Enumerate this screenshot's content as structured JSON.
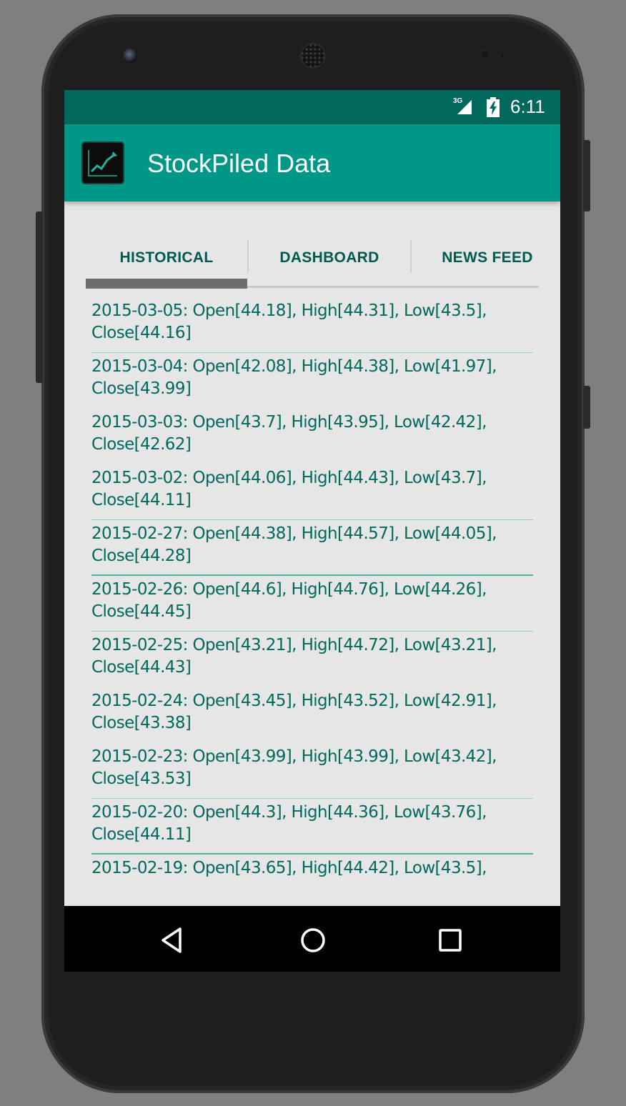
{
  "status_bar": {
    "network": "3G",
    "time": "6:11"
  },
  "app_bar": {
    "title": "StockPiled Data",
    "icon": "stock-chart-icon"
  },
  "tabs": [
    {
      "label": "HISTORICAL",
      "selected": true
    },
    {
      "label": "DASHBOARD",
      "selected": false
    },
    {
      "label": "NEWS FEED",
      "selected": false
    }
  ],
  "history": [
    {
      "line1": "2015-03-05: Open[44.18], High[44.31], Low[43.5],",
      "line2": "Close[44.16]"
    },
    {
      "line1": "2015-03-04: Open[42.08], High[44.38], Low[41.97],",
      "line2": "Close[43.99]"
    },
    {
      "line1": "2015-03-03: Open[43.7], High[43.95], Low[42.42],",
      "line2": "Close[42.62]"
    },
    {
      "line1": "2015-03-02: Open[44.06], High[44.43], Low[43.7],",
      "line2": "Close[44.11]"
    },
    {
      "line1": "2015-02-27: Open[44.38], High[44.57], Low[44.05],",
      "line2": "Close[44.28]"
    },
    {
      "line1": "2015-02-26: Open[44.6], High[44.76], Low[44.26],",
      "line2": "Close[44.45]"
    },
    {
      "line1": "2015-02-25: Open[43.21], High[44.72], Low[43.21],",
      "line2": "Close[44.43]"
    },
    {
      "line1": "2015-02-24: Open[43.45], High[43.52], Low[42.91],",
      "line2": "Close[43.38]"
    },
    {
      "line1": "2015-02-23: Open[43.99], High[43.99], Low[43.42],",
      "line2": "Close[43.53]"
    },
    {
      "line1": "2015-02-20: Open[44.3], High[44.36], Low[43.76],",
      "line2": "Close[44.11]"
    },
    {
      "line1": "2015-02-19: Open[43.65], High[44.42], Low[43.5],",
      "line2": ""
    }
  ],
  "nav_bar": {
    "back": "back-icon",
    "home": "home-icon",
    "recents": "recents-icon"
  },
  "colors": {
    "status_bar": "#00695c",
    "app_bar": "#009688",
    "text": "#00695c",
    "background": "#e6e6e6"
  }
}
